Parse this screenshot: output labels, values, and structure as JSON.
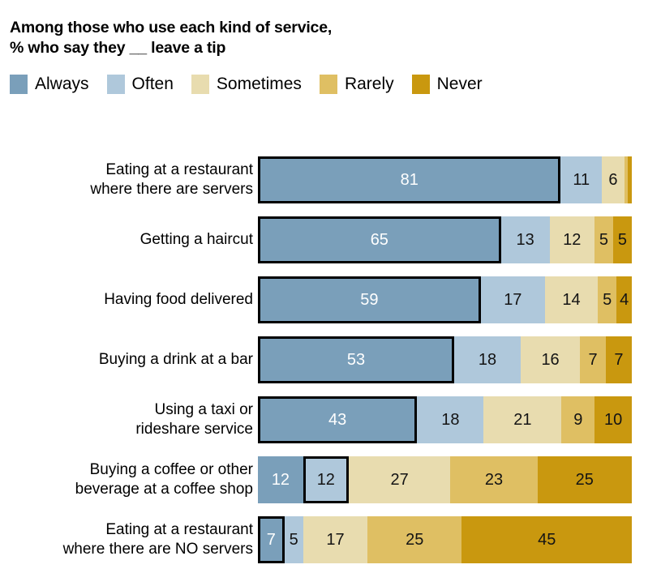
{
  "title": {
    "line1": "Among those who use each kind of service,",
    "line2": "% who say they __ leave a tip"
  },
  "legend": {
    "items": [
      {
        "label": "Always",
        "color": "#7A9FBA"
      },
      {
        "label": "Often",
        "color": "#AFC8DB"
      },
      {
        "label": "Sometimes",
        "color": "#E8DCAF"
      },
      {
        "label": "Rarely",
        "color": "#DFBF63"
      },
      {
        "label": "Never",
        "color": "#C9980F"
      }
    ]
  },
  "chart_data": {
    "type": "bar",
    "subtype": "stacked-horizontal-100",
    "title": "Among those who use each kind of service, % who say they __ leave a tip",
    "xlabel": "",
    "ylabel": "",
    "xlim": [
      0,
      100
    ],
    "grid": false,
    "legend_position": "top",
    "categories": [
      "Eating at a restaurant\nwhere there are servers",
      "Getting a haircut",
      "Having food delivered",
      "Buying a drink at a bar",
      "Using a taxi or\nrideshare service",
      "Buying a coffee or other\nbeverage at a coffee shop",
      "Eating at a restaurant\nwhere there are NO servers"
    ],
    "series": [
      {
        "name": "Always",
        "color": "#7A9FBA",
        "values": [
          81,
          65,
          59,
          53,
          43,
          12,
          7
        ]
      },
      {
        "name": "Often",
        "color": "#AFC8DB",
        "values": [
          11,
          13,
          17,
          18,
          18,
          12,
          5
        ]
      },
      {
        "name": "Sometimes",
        "color": "#E8DCAF",
        "values": [
          6,
          12,
          14,
          16,
          21,
          27,
          17
        ]
      },
      {
        "name": "Rarely",
        "color": "#DFBF63",
        "values": [
          1,
          5,
          5,
          7,
          9,
          23,
          25
        ]
      },
      {
        "name": "Never",
        "color": "#C9980F",
        "values": [
          1,
          5,
          4,
          7,
          10,
          25,
          45
        ]
      }
    ]
  },
  "rows": [
    {
      "label": "Eating at a restaurant\nwhere there are servers",
      "segments": [
        {
          "series": "Always",
          "value": 81,
          "text": "81",
          "show_label": true,
          "highlight": true
        },
        {
          "series": "Often",
          "value": 11,
          "text": "11",
          "show_label": true,
          "highlight": false
        },
        {
          "series": "Sometimes",
          "value": 6,
          "text": "6",
          "show_label": true,
          "highlight": false
        },
        {
          "series": "Rarely",
          "value": 1,
          "text": "",
          "show_label": false,
          "highlight": false
        },
        {
          "series": "Never",
          "value": 1,
          "text": "",
          "show_label": false,
          "highlight": false
        }
      ]
    },
    {
      "label": "Getting a haircut",
      "segments": [
        {
          "series": "Always",
          "value": 65,
          "text": "65",
          "show_label": true,
          "highlight": true
        },
        {
          "series": "Often",
          "value": 13,
          "text": "13",
          "show_label": true,
          "highlight": false
        },
        {
          "series": "Sometimes",
          "value": 12,
          "text": "12",
          "show_label": true,
          "highlight": false
        },
        {
          "series": "Rarely",
          "value": 5,
          "text": "5",
          "show_label": true,
          "highlight": false
        },
        {
          "series": "Never",
          "value": 5,
          "text": "5",
          "show_label": true,
          "highlight": false
        }
      ]
    },
    {
      "label": "Having food delivered",
      "segments": [
        {
          "series": "Always",
          "value": 59,
          "text": "59",
          "show_label": true,
          "highlight": true
        },
        {
          "series": "Often",
          "value": 17,
          "text": "17",
          "show_label": true,
          "highlight": false
        },
        {
          "series": "Sometimes",
          "value": 14,
          "text": "14",
          "show_label": true,
          "highlight": false
        },
        {
          "series": "Rarely",
          "value": 5,
          "text": "5",
          "show_label": true,
          "highlight": false
        },
        {
          "series": "Never",
          "value": 4,
          "text": "4",
          "show_label": true,
          "highlight": false
        }
      ]
    },
    {
      "label": "Buying a drink at a bar",
      "segments": [
        {
          "series": "Always",
          "value": 53,
          "text": "53",
          "show_label": true,
          "highlight": true
        },
        {
          "series": "Often",
          "value": 18,
          "text": "18",
          "show_label": true,
          "highlight": false
        },
        {
          "series": "Sometimes",
          "value": 16,
          "text": "16",
          "show_label": true,
          "highlight": false
        },
        {
          "series": "Rarely",
          "value": 7,
          "text": "7",
          "show_label": true,
          "highlight": false
        },
        {
          "series": "Never",
          "value": 7,
          "text": "7",
          "show_label": true,
          "highlight": false
        }
      ]
    },
    {
      "label": "Using a taxi or\nrideshare service",
      "segments": [
        {
          "series": "Always",
          "value": 43,
          "text": "43",
          "show_label": true,
          "highlight": true
        },
        {
          "series": "Often",
          "value": 18,
          "text": "18",
          "show_label": true,
          "highlight": false
        },
        {
          "series": "Sometimes",
          "value": 21,
          "text": "21",
          "show_label": true,
          "highlight": false
        },
        {
          "series": "Rarely",
          "value": 9,
          "text": "9",
          "show_label": true,
          "highlight": false
        },
        {
          "series": "Never",
          "value": 10,
          "text": "10",
          "show_label": true,
          "highlight": false
        }
      ]
    },
    {
      "label": "Buying a coffee or other\nbeverage at a coffee shop",
      "segments": [
        {
          "series": "Always",
          "value": 12,
          "text": "12",
          "show_label": true,
          "highlight": false
        },
        {
          "series": "Often",
          "value": 12,
          "text": "12",
          "show_label": true,
          "highlight": true
        },
        {
          "series": "Sometimes",
          "value": 27,
          "text": "27",
          "show_label": true,
          "highlight": false
        },
        {
          "series": "Rarely",
          "value": 23,
          "text": "23",
          "show_label": true,
          "highlight": false
        },
        {
          "series": "Never",
          "value": 25,
          "text": "25",
          "show_label": true,
          "highlight": false
        }
      ]
    },
    {
      "label": "Eating at a restaurant\nwhere there are NO servers",
      "segments": [
        {
          "series": "Always",
          "value": 7,
          "text": "7",
          "show_label": true,
          "highlight": true
        },
        {
          "series": "Often",
          "value": 5,
          "text": "5",
          "show_label": true,
          "highlight": false
        },
        {
          "series": "Sometimes",
          "value": 17,
          "text": "17",
          "show_label": true,
          "highlight": false
        },
        {
          "series": "Rarely",
          "value": 25,
          "text": "25",
          "show_label": true,
          "highlight": false
        },
        {
          "series": "Never",
          "value": 45,
          "text": "45",
          "show_label": true,
          "highlight": false
        }
      ]
    }
  ]
}
